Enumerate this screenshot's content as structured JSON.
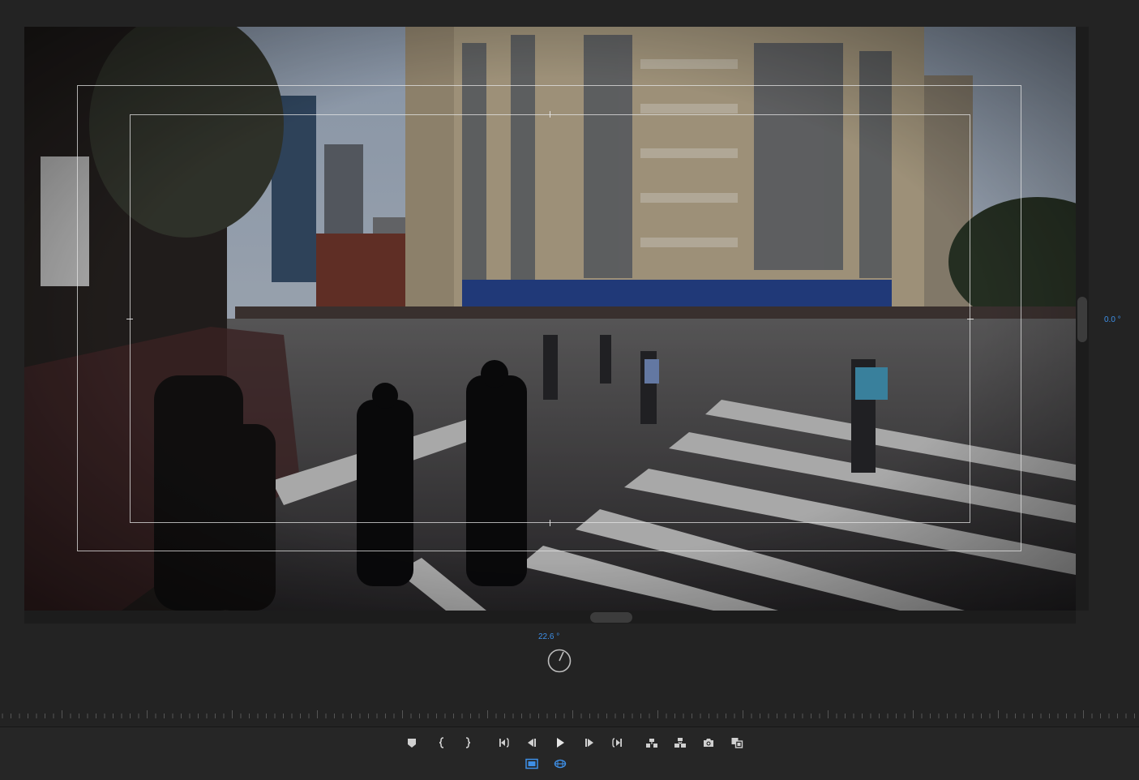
{
  "program_monitor": {
    "pan_readout": "0.0 °",
    "tilt_readout": "22.6 °"
  },
  "transport": {
    "buttons": [
      {
        "name": "add-marker-button",
        "icon": "marker-icon"
      },
      {
        "name": "mark-in-button",
        "icon": "mark-in-icon"
      },
      {
        "name": "mark-out-button",
        "icon": "mark-out-icon"
      },
      {
        "name": "go-to-in-button",
        "icon": "go-to-in-icon"
      },
      {
        "name": "step-back-button",
        "icon": "step-back-icon"
      },
      {
        "name": "play-button",
        "icon": "play-icon"
      },
      {
        "name": "step-forward-button",
        "icon": "step-forward-icon"
      },
      {
        "name": "go-to-out-button",
        "icon": "go-to-out-icon"
      },
      {
        "name": "lift-button",
        "icon": "lift-icon"
      },
      {
        "name": "extract-button",
        "icon": "extract-icon"
      },
      {
        "name": "export-frame-button",
        "icon": "camera-icon"
      },
      {
        "name": "comparison-view-button",
        "icon": "comparison-icon"
      },
      {
        "name": "safe-margins-button",
        "icon": "safe-margins-icon"
      },
      {
        "name": "vr-video-button",
        "icon": "vr-video-icon"
      }
    ]
  },
  "colors": {
    "accent": "#3e8fe6",
    "icon": "#d0d0d0",
    "panel_bg": "#232323"
  }
}
